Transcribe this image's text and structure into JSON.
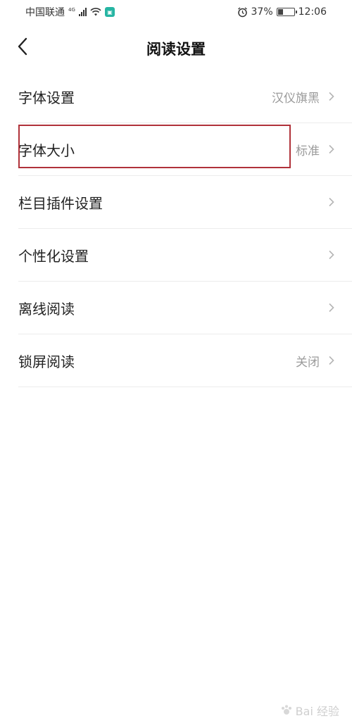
{
  "status_bar": {
    "carrier": "中国联通",
    "net_type": "4G",
    "battery": "37%",
    "battery_level": 0.37,
    "time": "12:06"
  },
  "header": {
    "title": "阅读设置"
  },
  "settings": [
    {
      "label": "字体设置",
      "value": "汉仪旗黑"
    },
    {
      "label": "字体大小",
      "value": "标准"
    },
    {
      "label": "栏目插件设置",
      "value": ""
    },
    {
      "label": "个性化设置",
      "value": ""
    },
    {
      "label": "离线阅读",
      "value": ""
    },
    {
      "label": "锁屏阅读",
      "value": "关闭"
    }
  ],
  "watermark": "Bai 经验",
  "colors": {
    "highlight": "#b0323a",
    "value_text": "#9b9b9b",
    "divider": "#ececec"
  }
}
